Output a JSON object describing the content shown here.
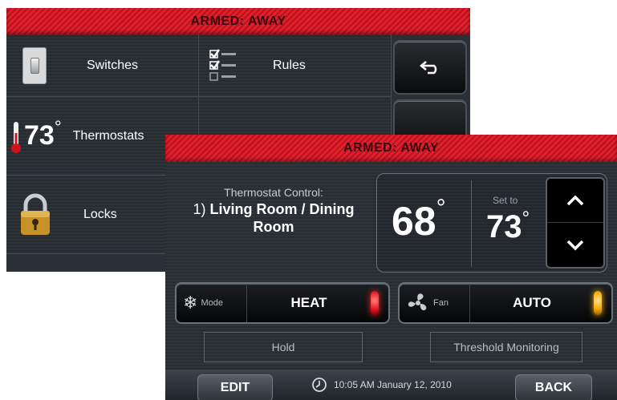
{
  "back_screen": {
    "banner": "ARMED: AWAY",
    "tiles": {
      "switches": "Switches",
      "rules": "Rules",
      "thermostats": "Thermostats",
      "thermostat_temp": "73",
      "locks": "Locks"
    }
  },
  "front_screen": {
    "banner": "ARMED: AWAY",
    "thermostat": {
      "title": "Thermostat Control:",
      "index": "1)",
      "room": "Living Room / Dining Room",
      "current_temp": "68",
      "set_label": "Set to",
      "set_temp": "73",
      "degree_symbol": "°"
    },
    "mode": {
      "label": "Mode",
      "value": "HEAT",
      "indicator_color": "#e0141e"
    },
    "fan": {
      "label": "Fan",
      "value": "AUTO",
      "indicator_color": "#f2a200"
    },
    "buttons": {
      "hold": "Hold",
      "threshold": "Threshold Monitoring"
    },
    "bottom": {
      "edit": "EDIT",
      "back": "BACK",
      "datetime": "10:05 AM January 12, 2010"
    }
  },
  "colors": {
    "banner_red": "#e0202c",
    "panel_bg": "#2a3036"
  }
}
